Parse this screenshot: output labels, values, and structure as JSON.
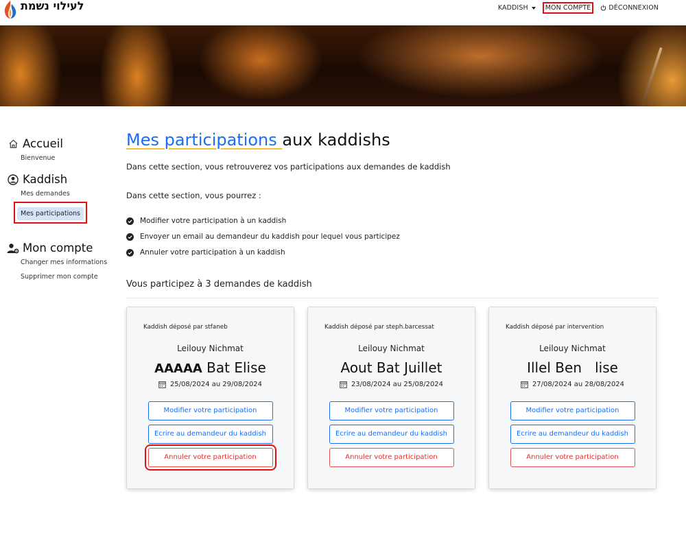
{
  "header": {
    "logo_text": "לעילוי נשמת",
    "nav": {
      "kaddish": "KADDISH",
      "mon_compte": "MON COMPTE",
      "deconnexion": "DÉCONNEXION"
    }
  },
  "sidebar": {
    "groups": [
      {
        "title": "Accueil",
        "icon": "home-icon",
        "links": [
          "Bienvenue"
        ]
      },
      {
        "title": "Kaddish",
        "icon": "user-circle-icon",
        "links": [
          "Mes demandes",
          "Mes participations"
        ]
      },
      {
        "title": "Mon compte",
        "icon": "user-gear-icon",
        "links": [
          "Changer mes informations",
          "Supprimer mon compte"
        ]
      }
    ]
  },
  "main": {
    "title_highlight": "Mes participations ",
    "title_rest": "aux kaddishs",
    "intro": "Dans cette section, vous retrouverez vos participations aux demandes de kaddish",
    "subintro": "Dans cette section, vous pourrez :",
    "checklist": [
      "Modifier votre participation à un kaddish",
      "Envoyer un email au demandeur du kaddish pour lequel vous participez",
      "Annuler votre participation à un kaddish"
    ],
    "count_text": "Vous participez à 3 demandes de kaddish"
  },
  "cards": [
    {
      "owner": "Kaddish déposé par stfaneb",
      "prefix": "Leilouy Nichmat",
      "name_first": "AAAAA",
      "name_rest": " Bat Elise",
      "dates": "25/08/2024 au 29/08/2024",
      "btn_modify": "Modifier votre participation",
      "btn_write": "Ecrire au demandeur du kaddish",
      "btn_cancel": "Annuler votre participation"
    },
    {
      "owner": "Kaddish déposé par steph.barcessat",
      "prefix": "Leilouy Nichmat",
      "name_first": "",
      "name_rest": "Aout Bat Juillet",
      "dates": "23/08/2024 au 25/08/2024",
      "btn_modify": "Modifier votre participation",
      "btn_write": "Ecrire au demandeur du kaddish",
      "btn_cancel": "Annuler votre participation"
    },
    {
      "owner": "Kaddish déposé par intervention",
      "prefix": "Leilouy Nichmat",
      "name_first": "",
      "name_rest": "Illel Ben   lise",
      "dates": "27/08/2024 au 28/08/2024",
      "btn_modify": "Modifier votre participation",
      "btn_write": "Ecrire au demandeur du kaddish",
      "btn_cancel": "Annuler votre participation"
    }
  ],
  "colors": {
    "accent_blue": "#1a6ef5",
    "danger_red": "#e03030",
    "highlight_red": "#e01010",
    "active_bg": "#d7e4f7"
  }
}
